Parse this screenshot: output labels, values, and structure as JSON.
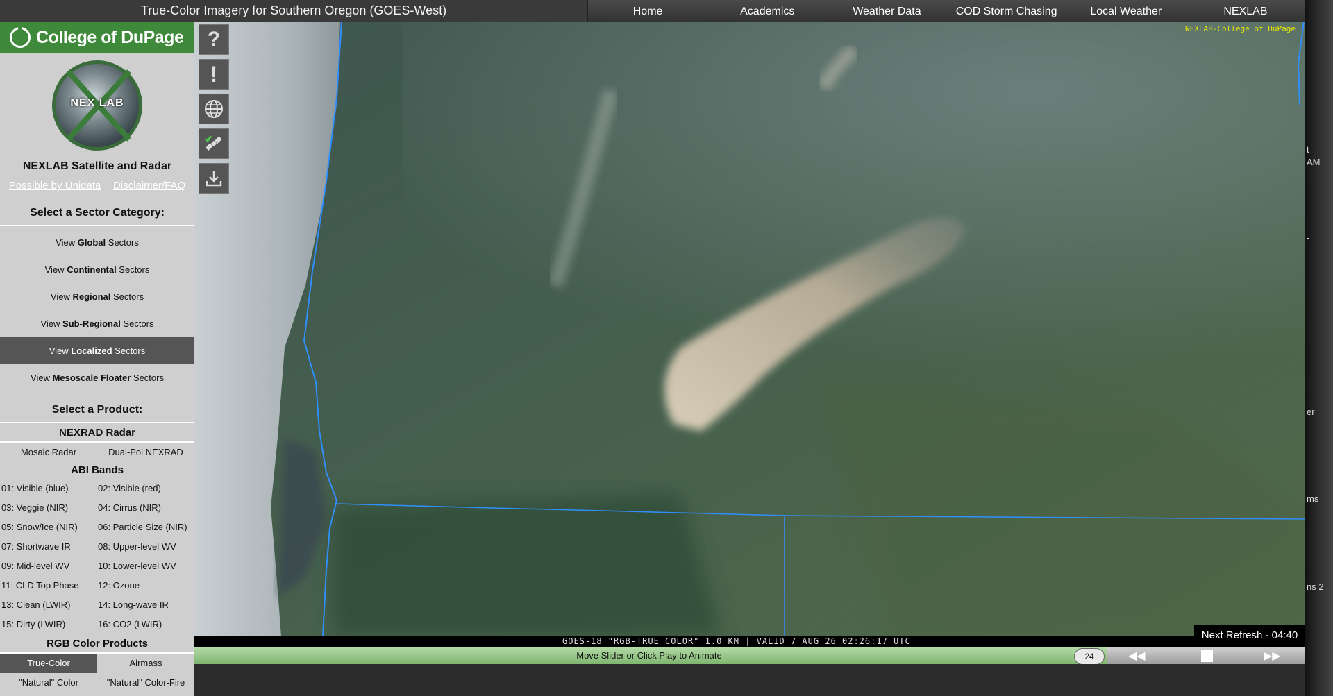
{
  "header": {
    "title": "True-Color Imagery for Southern Oregon (GOES-West)",
    "nav": [
      "Home",
      "Academics",
      "Weather Data",
      "COD Storm Chasing",
      "Local Weather",
      "NEXLAB"
    ]
  },
  "sidebar": {
    "college_name": "College of DuPage",
    "logo_text": "NEX LAB",
    "site_title": "NEXLAB Satellite and Radar",
    "links": [
      "Possible by Unidata",
      "Disclaimer/FAQ"
    ],
    "sector_heading": "Select a Sector Category:",
    "sectors": [
      {
        "prefix": "View ",
        "bold": "Global",
        "suffix": " Sectors",
        "active": false
      },
      {
        "prefix": "View ",
        "bold": "Continental",
        "suffix": " Sectors",
        "active": false
      },
      {
        "prefix": "View ",
        "bold": "Regional",
        "suffix": " Sectors",
        "active": false
      },
      {
        "prefix": "View ",
        "bold": "Sub-Regional",
        "suffix": " Sectors",
        "active": false
      },
      {
        "prefix": "View ",
        "bold": "Localized",
        "suffix": " Sectors",
        "active": true
      },
      {
        "prefix": "View ",
        "bold": "Mesoscale Floater",
        "suffix": " Sectors",
        "active": false
      }
    ],
    "product_heading": "Select a Product:",
    "radar_heading": "NEXRAD Radar",
    "radar_products": [
      "Mosaic Radar",
      "Dual-Pol NEXRAD"
    ],
    "abi_heading": "ABI Bands",
    "abi_bands": [
      [
        "01: Visible (blue)",
        "02: Visible (red)"
      ],
      [
        "03: Veggie (NIR)",
        "04: Cirrus (NIR)"
      ],
      [
        "05: Snow/Ice (NIR)",
        "06: Particle Size (NIR)"
      ],
      [
        "07: Shortwave IR",
        "08: Upper-level WV"
      ],
      [
        "09: Mid-level WV",
        "10: Lower-level WV"
      ],
      [
        "11: CLD Top Phase",
        "12: Ozone"
      ],
      [
        "13: Clean (LWIR)",
        "14: Long-wave IR"
      ],
      [
        "15: Dirty (LWIR)",
        "16: CO2 (LWIR)"
      ]
    ],
    "rgb_heading": "RGB Color Products",
    "rgb_products": [
      {
        "label": "True-Color",
        "active": true
      },
      {
        "label": "Airmass",
        "active": false
      },
      {
        "label": "\"Natural\" Color",
        "active": false
      },
      {
        "label": "\"Natural\" Color-Fire",
        "active": false
      }
    ]
  },
  "tools": [
    {
      "name": "help-icon",
      "glyph": "?"
    },
    {
      "name": "alert-icon",
      "glyph": "!"
    },
    {
      "name": "globe-icon",
      "glyph": "globe"
    },
    {
      "name": "satellite-icon",
      "glyph": "sat"
    },
    {
      "name": "download-icon",
      "glyph": "dl"
    }
  ],
  "image": {
    "watermark": "NEXLAB-College of DuPage",
    "caption": "GOES-18 \"RGB-TRUE COLOR\" 1.0 KM | VALID 7 AUG 26 02:26:17 UTC",
    "next_refresh": "Next Refresh - 04:40"
  },
  "animation": {
    "hint": "Move Slider or Click Play to Animate",
    "frame_count": "24",
    "controls": [
      "rewind",
      "stop",
      "fast-forward"
    ]
  },
  "background_page_fragments": [
    "t",
    "AM",
    "-",
    "er",
    "ms",
    "ns 2"
  ],
  "colors": {
    "cod_green": "#3f8a3a",
    "sidebar_bg": "#cfcfcf",
    "active_item": "#555555",
    "anim_bar": "#7fb56f",
    "watermark": "#e8e800",
    "boundary_line": "#2f8fff"
  }
}
